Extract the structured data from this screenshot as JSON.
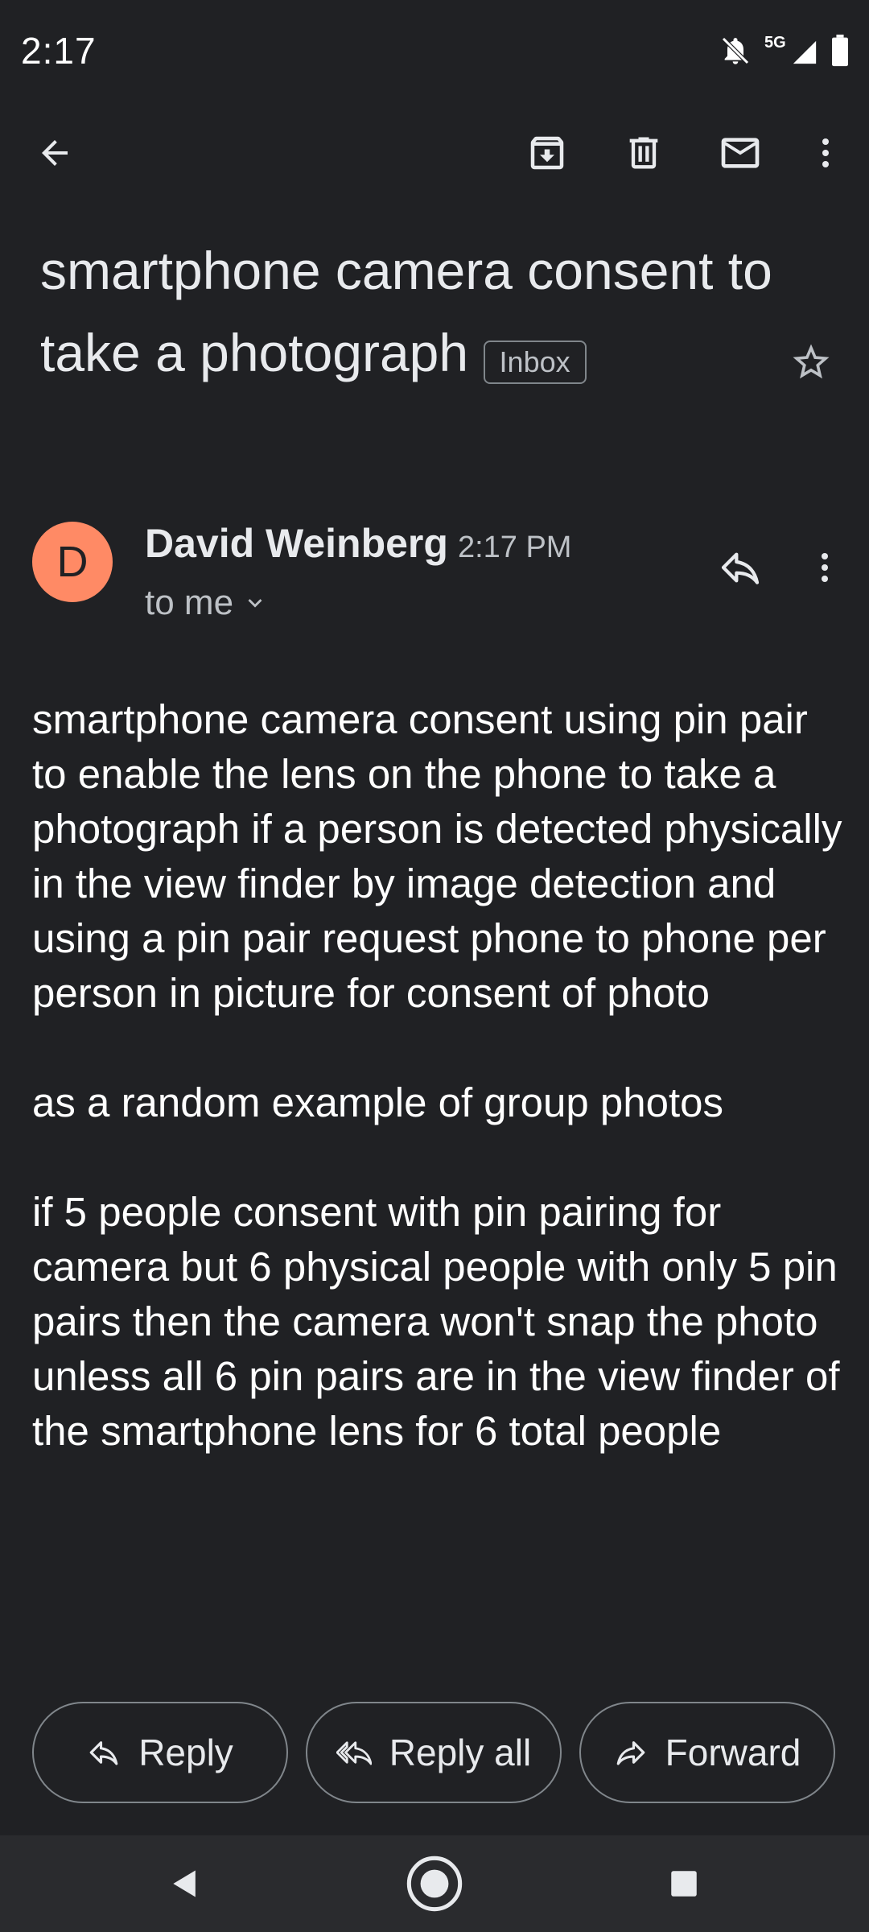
{
  "status_bar": {
    "time": "2:17",
    "network": "5G",
    "icons": [
      "notifications-off-icon",
      "signal-icon",
      "battery-icon"
    ]
  },
  "toolbar": {
    "icons": [
      "back-arrow-icon",
      "archive-icon",
      "delete-icon",
      "mark-unread-icon",
      "more-vert-icon"
    ]
  },
  "email": {
    "subject": "smartphone camera consent to take a photograph",
    "label": "Inbox",
    "sender_name": "David Weinberg",
    "sender_initial": "D",
    "time": "2:17 PM",
    "recipient": "to me",
    "body": [
      "smartphone camera consent using pin pair to enable the lens on the phone to take a photograph if a person is detected physically in the view finder by image detection and using a pin pair request phone to phone per person in picture for consent of photo",
      "as a random example of group photos",
      "if 5 people consent with pin pairing for camera but 6 physical people with only 5 pin pairs then the camera won't snap the photo unless all 6 pin pairs are in the view finder of the smartphone lens for 6 total people"
    ]
  },
  "actions": {
    "reply": "Reply",
    "reply_all": "Reply all",
    "forward": "Forward"
  },
  "colors": {
    "background": "#202124",
    "avatar": "#ff8a65",
    "text": "#e8eaed",
    "secondary_text": "#bdc1c6",
    "outline": "#80868b",
    "nav_bar": "#2a2b2e"
  },
  "nav_bar": {
    "icons": [
      "nav-back-icon",
      "nav-home-icon",
      "nav-recents-icon"
    ]
  }
}
